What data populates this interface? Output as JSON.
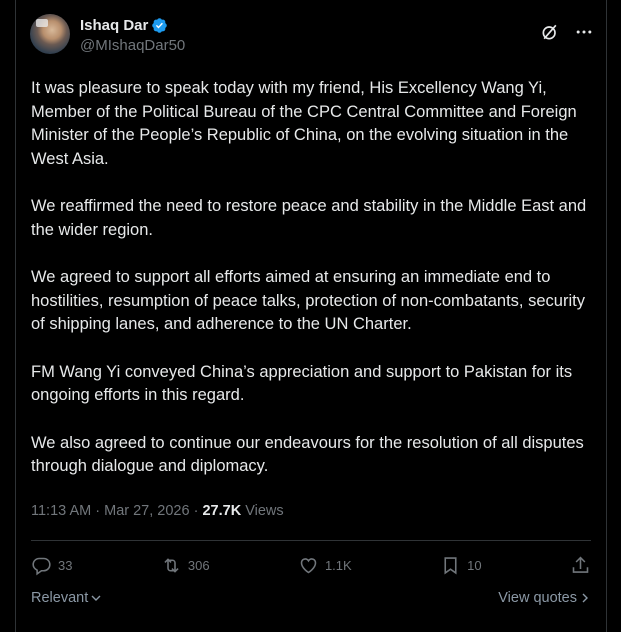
{
  "author": {
    "display_name": "Ishaq Dar",
    "handle": "@MIshaqDar50"
  },
  "icons": {
    "verified": "verified-badge-icon",
    "grok": "grok-icon",
    "more": "more-icon",
    "reply": "reply-icon",
    "repost": "repost-icon",
    "like": "heart-icon",
    "bookmark": "bookmark-icon",
    "share": "share-icon"
  },
  "colors": {
    "background": "#000000",
    "text": "#e7e9ea",
    "muted": "#71767b",
    "verified": "#1d9bf0",
    "border": "#2f3336"
  },
  "post": {
    "paragraphs": [
      "It was pleasure to speak today with my friend, His Excellency Wang Yi, Member of the Political Bureau of the CPC Central Committee and Foreign Minister of the People’s Republic of China, on the evolving situation in the West Asia.",
      "We reaffirmed the need to restore peace and stability in the Middle East and the wider region.",
      "We agreed to support all efforts aimed at ensuring an immediate end to hostilities, resumption of peace talks, protection of non-combatants, security of shipping lanes, and adherence to the UN Charter.",
      "FM Wang Yi conveyed China’s appreciation and support to Pakistan for its ongoing efforts in this regard.",
      "We also agreed to continue our endeavours for the resolution of all disputes through dialogue and diplomacy."
    ],
    "time": "11:13 AM",
    "separator": "·",
    "date": "Mar 27, 2026",
    "views_count": "27.7K",
    "views_label": "Views"
  },
  "actions": {
    "replies": "33",
    "reposts": "306",
    "likes": "1.1K",
    "bookmarks": "10"
  },
  "footer": {
    "sort_label": "Relevant",
    "view_quotes_label": "View quotes"
  }
}
